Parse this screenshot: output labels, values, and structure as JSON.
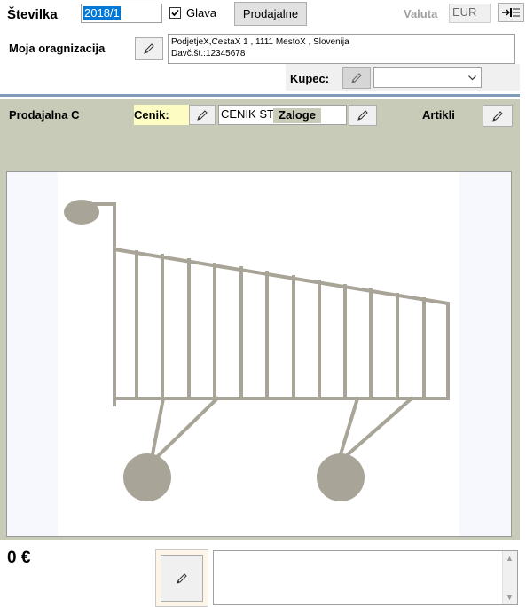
{
  "header": {
    "stevilka_label": "Številka",
    "stevilka_value": "2018/1",
    "glava_label": "Glava",
    "glava_checked": true,
    "prodajalne_button": "Prodajalne",
    "valuta_label": "Valuta",
    "valuta_value": "EUR"
  },
  "organization": {
    "label": "Moja oragnizacija",
    "line1": "PodjetjeX,CestaX 1 , 1111 MestoX , Slovenija",
    "line2": "Davč.št.:12345678"
  },
  "kupec": {
    "label": "Kupec:",
    "selected": ""
  },
  "toolbar": {
    "prodajalna_label": "Prodajalna C",
    "cenik_label": "Cenik:",
    "cenik_value": "CENIK ST",
    "zaloge_label": "Zaloge",
    "artikli_label": "Artikli"
  },
  "footer": {
    "total": "0 €"
  },
  "colors": {
    "panel_bg": "#c8cbb8",
    "cenik_highlight": "#fdfcc2",
    "cart_color": "#a8a497",
    "selection": "#0078d7"
  }
}
